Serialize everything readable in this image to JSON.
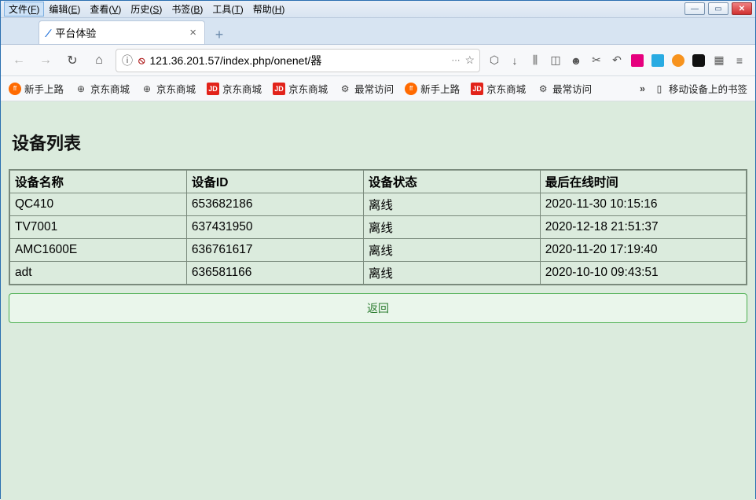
{
  "menubar": {
    "items": [
      {
        "label": "文件",
        "key": "F"
      },
      {
        "label": "编辑",
        "key": "E"
      },
      {
        "label": "查看",
        "key": "V"
      },
      {
        "label": "历史",
        "key": "S"
      },
      {
        "label": "书签",
        "key": "B"
      },
      {
        "label": "工具",
        "key": "T"
      },
      {
        "label": "帮助",
        "key": "H"
      }
    ]
  },
  "tab": {
    "title": "平台体验"
  },
  "urlbar": {
    "url": "121.36.201.57/index.php/onenet/器"
  },
  "bookmarks": {
    "items": [
      {
        "icon": "ff",
        "label": "新手上路"
      },
      {
        "icon": "globe",
        "label": "京东商城"
      },
      {
        "icon": "globe",
        "label": "京东商城"
      },
      {
        "icon": "jd",
        "label": "京东商城"
      },
      {
        "icon": "jd",
        "label": "京东商城"
      },
      {
        "icon": "gear",
        "label": "最常访问"
      },
      {
        "icon": "ff",
        "label": "新手上路"
      },
      {
        "icon": "jd",
        "label": "京东商城"
      },
      {
        "icon": "gear",
        "label": "最常访问"
      }
    ],
    "mobile": "移动设备上的书签"
  },
  "page": {
    "title": "设备列表",
    "columns": [
      "设备名称",
      "设备ID",
      "设备状态",
      "最后在线时间"
    ],
    "rows": [
      {
        "name": "QC410",
        "id": "653682186",
        "status": "离线",
        "last": "2020-11-30 10:15:16"
      },
      {
        "name": "TV7001",
        "id": "637431950",
        "status": "离线",
        "last": "2020-12-18 21:51:37"
      },
      {
        "name": "AMC1600E",
        "id": "636761617",
        "status": "离线",
        "last": "2020-11-20 17:19:40"
      },
      {
        "name": "adt",
        "id": "636581166",
        "status": "离线",
        "last": "2020-10-10 09:43:51"
      }
    ],
    "back": "返回"
  }
}
